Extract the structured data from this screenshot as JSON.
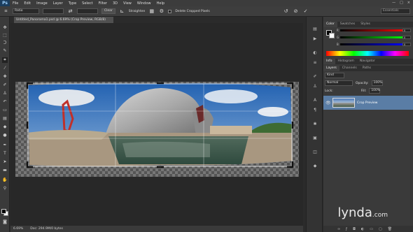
{
  "app": {
    "logo": "Ps"
  },
  "menu": [
    "File",
    "Edit",
    "Image",
    "Layer",
    "Type",
    "Select",
    "Filter",
    "3D",
    "View",
    "Window",
    "Help"
  ],
  "window_controls": [
    "—",
    "□",
    "×"
  ],
  "options": {
    "ratio_value": "Ratio",
    "clear_label": "Clear",
    "straighten_label": "Straighten",
    "delete_cropped_label": "Delete Cropped Pixels",
    "workspace_value": "Essentials"
  },
  "document": {
    "tab_title": "Untitled_Panorama1.psd @ 6.69% (Crop Preview, RGB/8)",
    "zoom": "6.69%",
    "doc_info": "Doc: 294.9M/0 bytes"
  },
  "panels": {
    "color_tabs": [
      "Color",
      "Swatches",
      "Styles"
    ],
    "rgb_labels": [
      "R",
      "G",
      "B"
    ],
    "rgb_values": [
      "0",
      "0",
      "0"
    ],
    "info_tabs": [
      "Info",
      "Histogram",
      "Navigator"
    ],
    "layers_tabs": [
      "Layers",
      "Channels",
      "Paths"
    ],
    "kind_label": "Kind",
    "blend_mode": "Normal",
    "opacity_label": "Opacity:",
    "opacity_value": "100%",
    "lock_label": "Lock:",
    "fill_label": "Fill:",
    "fill_value": "100%",
    "layer_name": "Crop Preview"
  },
  "watermark": {
    "text": "lynda",
    "suffix": ".com"
  },
  "colors": {
    "accent": "#5a7da5",
    "background": "#2b2b2b",
    "panel": "#3a3a3a"
  }
}
